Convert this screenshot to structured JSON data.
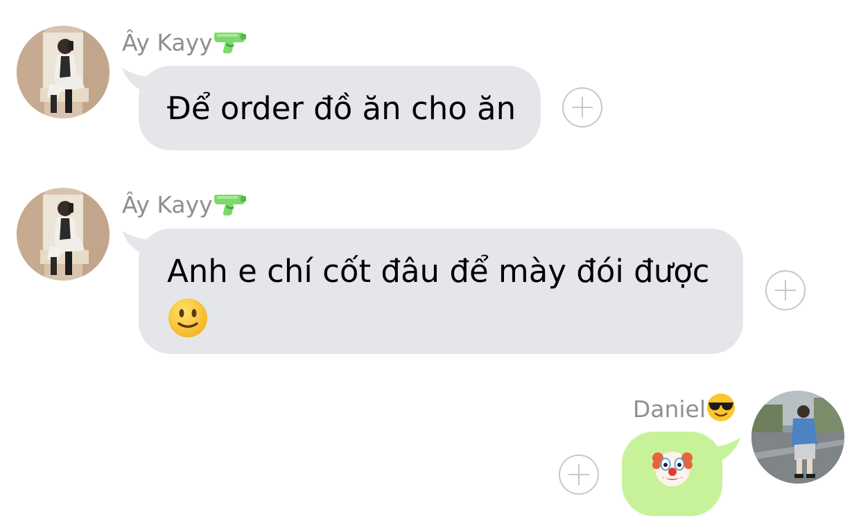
{
  "messages": [
    {
      "direction": "incoming",
      "sender": "Ây Kayy",
      "sender_emoji": "water-pistol-icon",
      "text": "Để order đồ ăn cho ăn"
    },
    {
      "direction": "incoming",
      "sender": "Ây Kayy",
      "sender_emoji": "water-pistol-icon",
      "text": "Anh e chí cốt đâu để mày đói được",
      "trailing_emoji": "slightly-smiling-face-icon"
    },
    {
      "direction": "outgoing",
      "sender": "Daniel",
      "sender_emoji": "sunglasses-face-icon",
      "content_emoji": "clown-face-icon"
    }
  ],
  "colors": {
    "incoming_bubble": "#e5e6ea",
    "outgoing_bubble": "#c8f29a",
    "sender_name": "#8e8e93",
    "plus_button": "#c7c7cc"
  }
}
